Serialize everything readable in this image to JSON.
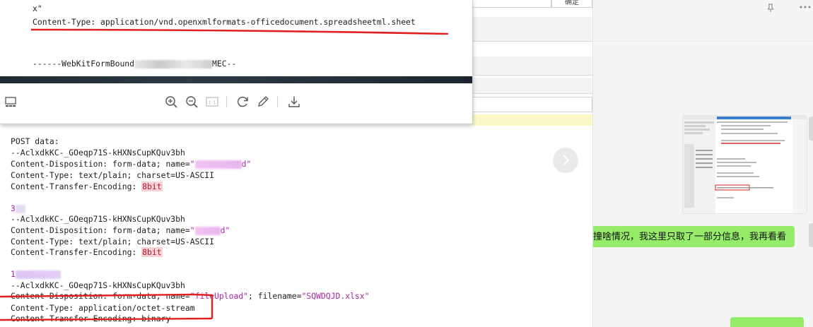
{
  "viewer": {
    "image_lines": [
      "x\"",
      "Content-Type: application/vnd.openxmlformats-officedocument.spreadsheetml.sheet",
      "------WebKitFormBound",
      "MEC--"
    ],
    "toolbar": {
      "icons": [
        "thumbnail-icon",
        "zoom-in-icon",
        "zoom-out-icon",
        "actual-size-icon",
        "rotate-icon",
        "edit-icon",
        "download-icon"
      ],
      "actual_size_label": "1:1"
    }
  },
  "editor": {
    "top_button_label": "确定",
    "post_label": "POST data:",
    "boundary": "--AclxdkKC-_GOeqp71S-kHXNsCupKQuv3bh",
    "disp_form_data_prefix": "Content-Disposition: form-data; name=",
    "name_tail_1": "d\"",
    "name_open_quote": "\"",
    "content_type_plain": "Content-Type: text/plain; charset=US-ASCII",
    "cte_label": "Content-Transfer-Encoding: ",
    "cte_value": "8bit",
    "value_prefix_1": "3",
    "value_prefix_2": "1",
    "name_tail_2": "d\"",
    "disp_file_prefix": "Content-Disposition: form-data; name=",
    "file_field_name": "\"fileUpload\"",
    "filename_label": "; filename=",
    "filename_value": "\"SQWDQJD.xlsx\"",
    "content_type_octet": "Content-Type: application/octet-stream",
    "cte_binary": "Content-Transfer-Encoding: binary"
  },
  "chat": {
    "message_text": "撞啥情况，我这里只取了一部分信息，我再看看"
  },
  "colors": {
    "annotation_red": "#e02020",
    "chat_bubble_green": "#95ec69",
    "code_keyword_pink": "#f7d3d5",
    "string_purple": "#a626a4"
  }
}
